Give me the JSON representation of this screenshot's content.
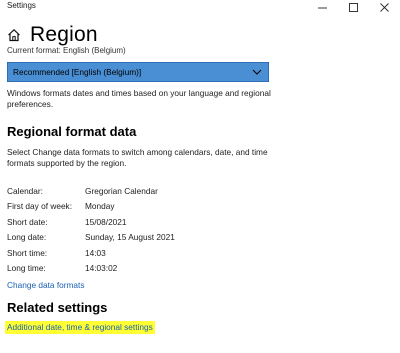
{
  "window": {
    "title": "Settings",
    "minimize": "—",
    "maximize": "☐",
    "close": "✕"
  },
  "header": {
    "icon": "home-icon",
    "title": "Region"
  },
  "current_format_label": "Current format: English (Belgium)",
  "format_select": {
    "value": "Recommended [English (Belgium)]"
  },
  "format_description": "Windows formats dates and times based on your language and regional preferences.",
  "regional_format": {
    "title": "Regional format data",
    "description": "Select Change data formats to switch among calendars, date, and time formats supported by the region.",
    "rows": [
      {
        "label": "Calendar:",
        "value": "Gregorian Calendar"
      },
      {
        "label": "First day of week:",
        "value": "Monday"
      },
      {
        "label": "Short date:",
        "value": "15/08/2021"
      },
      {
        "label": "Long date:",
        "value": "Sunday, 15 August 2021"
      },
      {
        "label": "Short time:",
        "value": "14:03"
      },
      {
        "label": "Long time:",
        "value": "14:03:02"
      }
    ],
    "change_link": "Change data formats"
  },
  "related": {
    "title": "Related settings",
    "additional_link": "Additional date, time & regional settings",
    "highlight_color": "#ffff33"
  },
  "colors": {
    "accent": "#1a5fb4",
    "select_bg": "#4a8fd3"
  }
}
